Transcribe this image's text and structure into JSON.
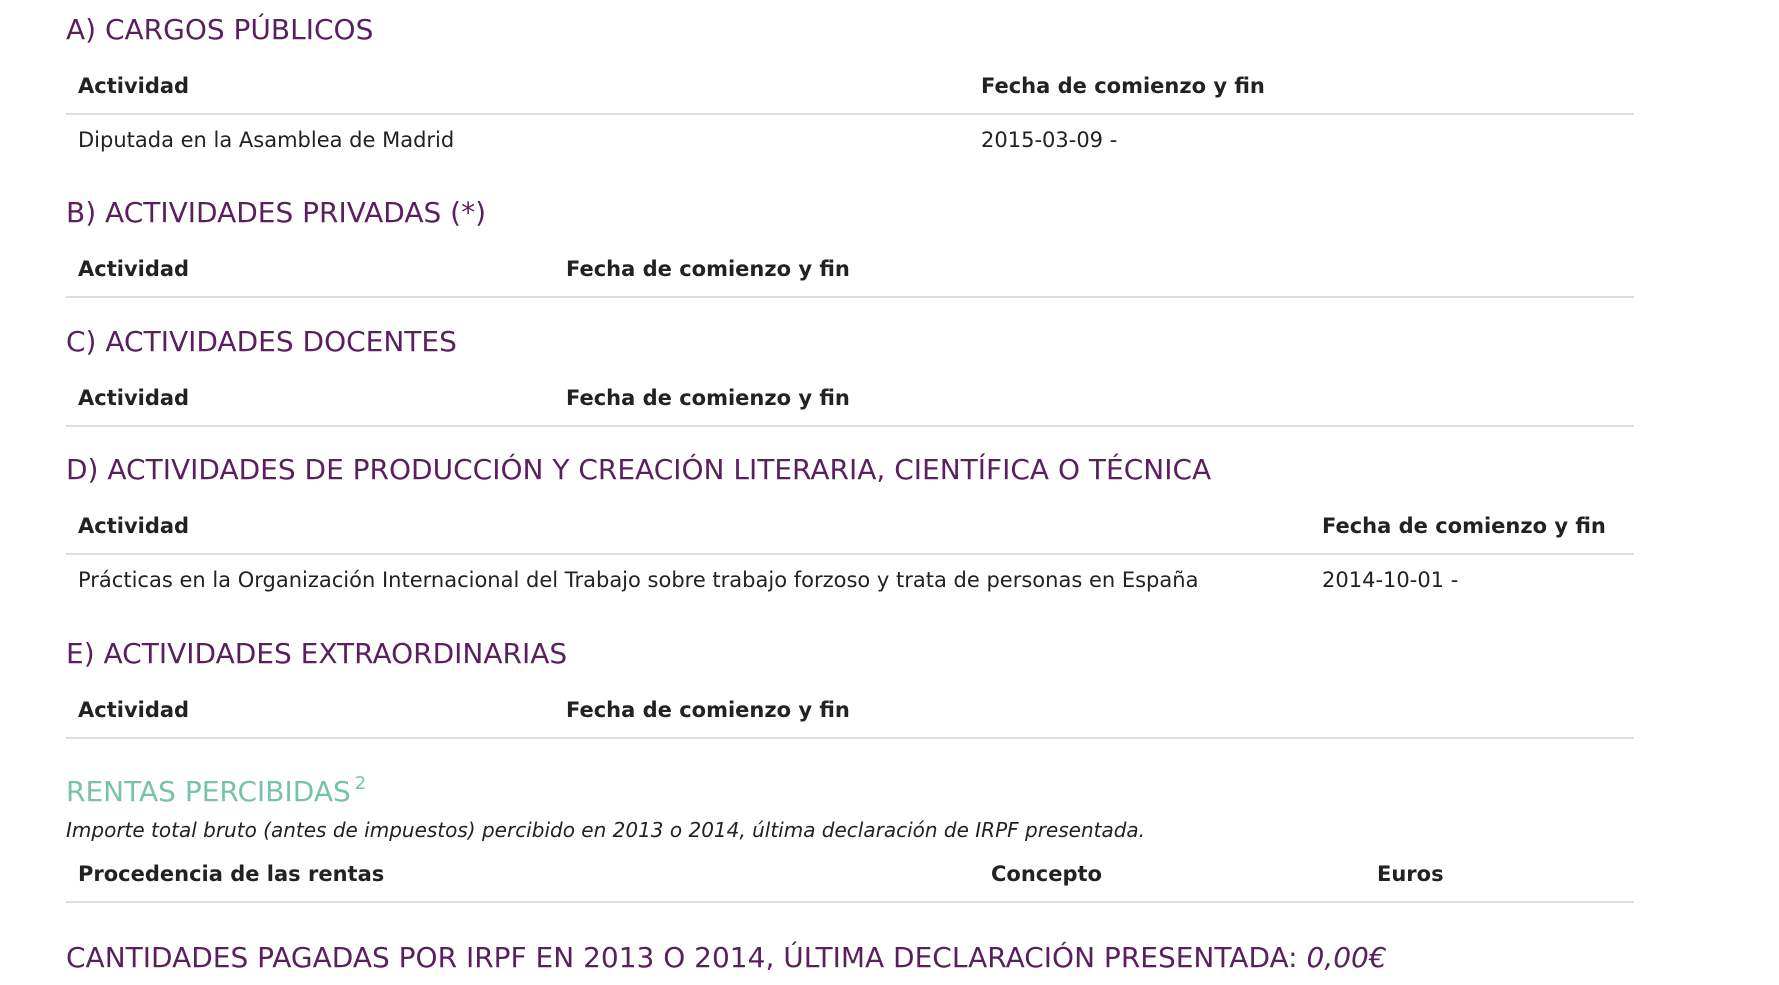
{
  "sections": {
    "a": {
      "title": "A) CARGOS PÚBLICOS",
      "col_activity": "Actividad",
      "col_dates": "Fecha de comienzo y fin",
      "rows": [
        {
          "activity": "Diputada en la Asamblea de Madrid",
          "dates": "2015-03-09 -"
        }
      ]
    },
    "b": {
      "title": "B) ACTIVIDADES PRIVADAS (*)",
      "col_activity": "Actividad",
      "col_dates": "Fecha de comienzo y fin"
    },
    "c": {
      "title": "C) ACTIVIDADES DOCENTES",
      "col_activity": "Actividad",
      "col_dates": "Fecha de comienzo y fin"
    },
    "d": {
      "title": "D) ACTIVIDADES DE PRODUCCIÓN Y CREACIÓN LITERARIA, CIENTÍFICA O TÉCNICA",
      "col_activity": "Actividad",
      "col_dates": "Fecha de comienzo y fin",
      "rows": [
        {
          "activity": "Prácticas en la Organización Internacional del Trabajo sobre trabajo forzoso y trata de personas en España",
          "dates": "2014-10-01 -"
        }
      ]
    },
    "e": {
      "title": "E) ACTIVIDADES EXTRAORDINARIAS",
      "col_activity": "Actividad",
      "col_dates": "Fecha de comienzo y fin"
    }
  },
  "rentas": {
    "title": "RENTAS PERCIBIDAS",
    "footnote": "2",
    "subtitle": "Importe total bruto (antes de impuestos) percibido en 2013 o 2014, última declaración de IRPF presentada.",
    "col_source": "Procedencia de las rentas",
    "col_concept": "Concepto",
    "col_euros": "Euros"
  },
  "irpf": {
    "title": "CANTIDADES PAGADAS POR IRPF EN 2013 O 2014, ÚLTIMA DECLARACIÓN PRESENTADA: ",
    "amount": "0,00€"
  },
  "colors": {
    "section_title": "#5a1f5e",
    "rentas_title": "#7ac1ad",
    "text": "#222222",
    "divider": "#dddddd"
  }
}
